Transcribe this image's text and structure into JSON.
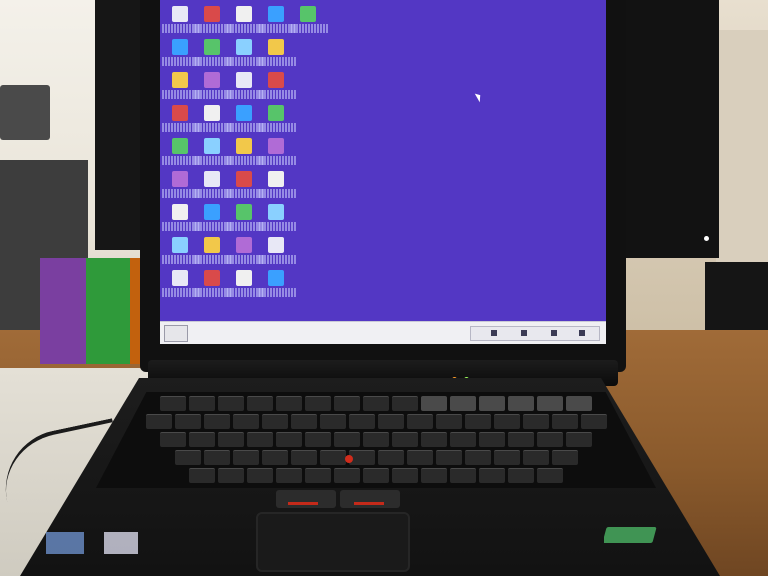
{
  "scene": {
    "description_kind": "photo",
    "subject": "laptop-on-desk"
  },
  "desktop": {
    "background_color": "#5337c4",
    "taskbar_color": "#f0f0f3",
    "icon_count": 37
  },
  "colors": {
    "trackpoint": "#d02c1c",
    "status_led_1": "#ff9c2a",
    "status_led_2": "#9cff5a",
    "ibm_logo": "#4fbf6a"
  },
  "icons": {
    "desktop_icon": "desktop-shortcut-icon",
    "ibm_logo": "ibm-logo"
  }
}
